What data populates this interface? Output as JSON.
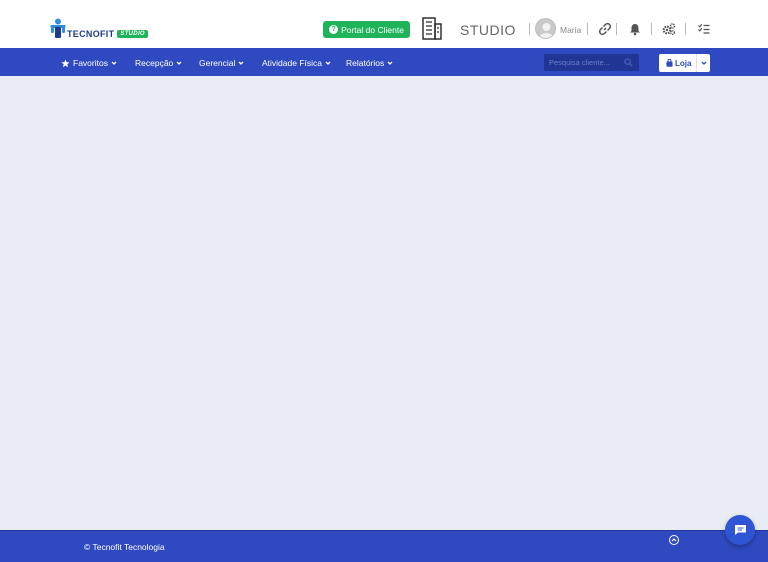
{
  "header": {
    "logo": {
      "word_a": "TECNO",
      "word_b": "FIT",
      "badge": "STUDIO"
    },
    "portal_button": "Portal do Cliente",
    "studio_label": "STUDIO",
    "user_name": "Maria",
    "icons": [
      "link-icon",
      "bell-icon",
      "cogs-icon",
      "tasks-icon"
    ]
  },
  "nav": {
    "items": [
      {
        "label": "Favoritos",
        "icon": "star-icon"
      },
      {
        "label": "Recepção"
      },
      {
        "label": "Gerencial"
      },
      {
        "label": "Atividade Física"
      },
      {
        "label": "Relatórios"
      }
    ],
    "search_placeholder": "Pesquisa cliente...",
    "store_button": "Loja"
  },
  "footer": {
    "copyright": "© Tecnofit Tecnologia"
  },
  "colors": {
    "brand_blue": "#2f4ac0",
    "brand_green": "#1fb35a",
    "background": "#e9ecf2"
  }
}
